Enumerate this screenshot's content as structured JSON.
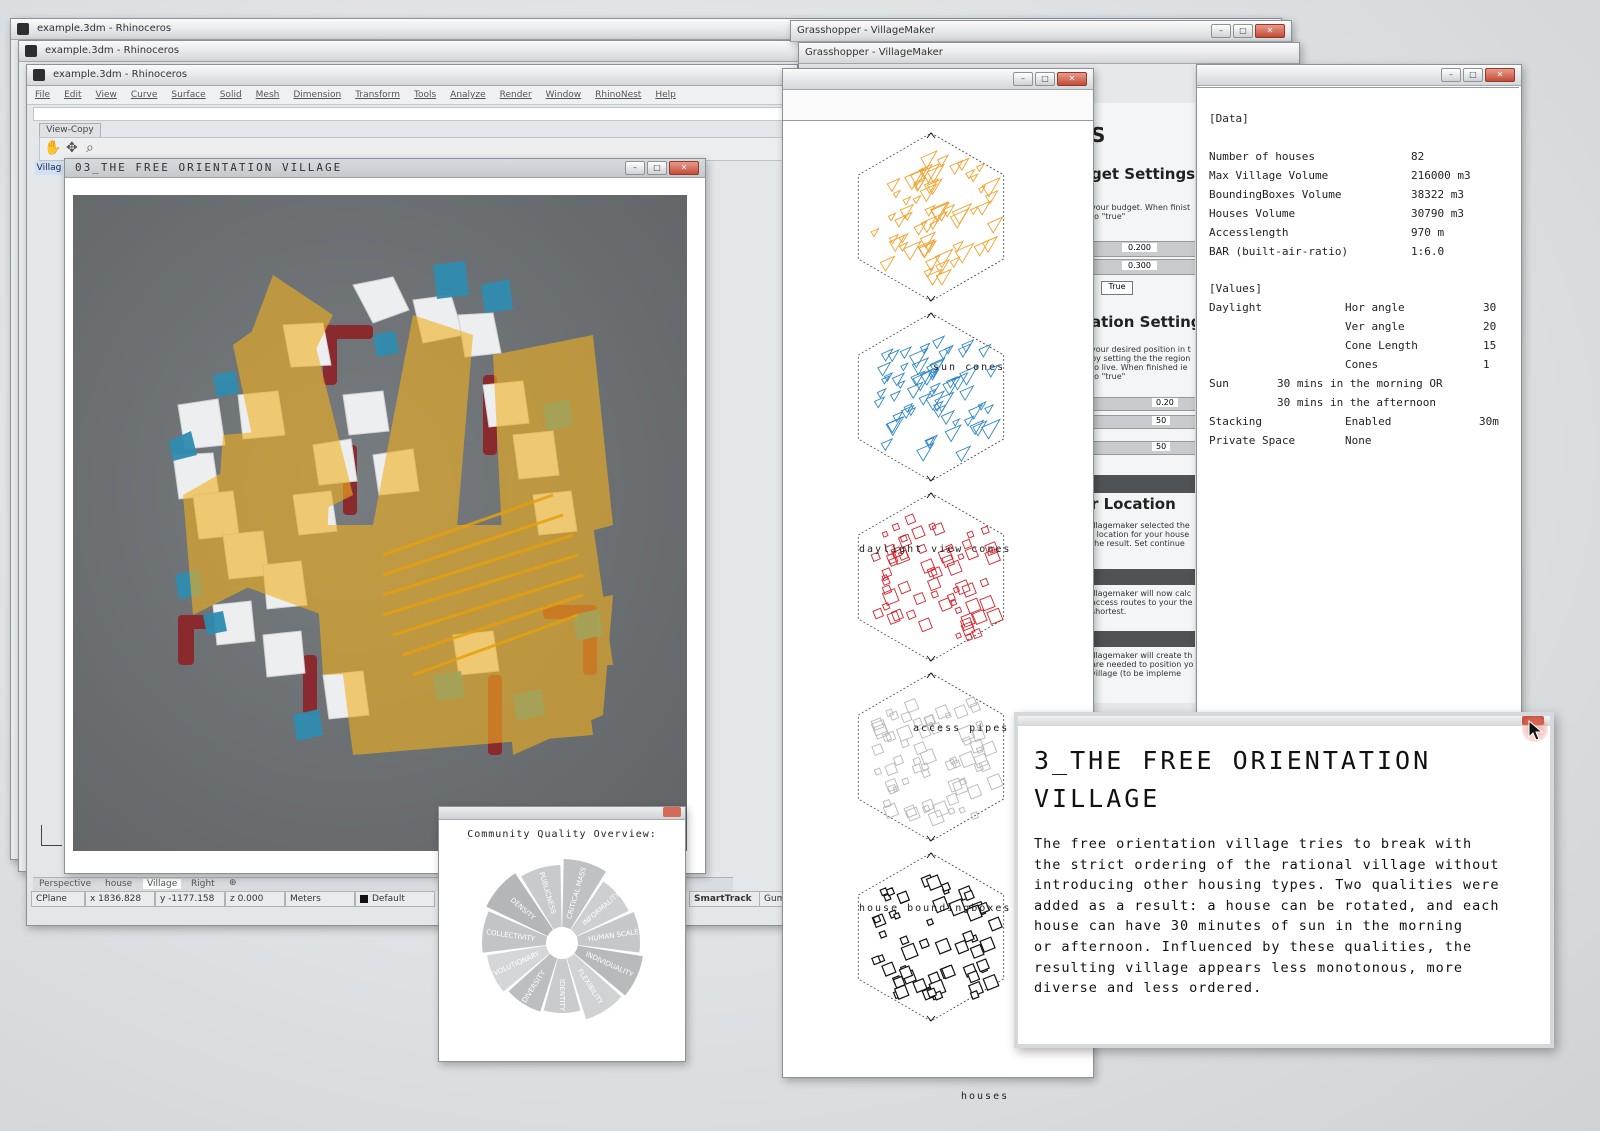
{
  "rhino_back1": {
    "title": "example.3dm - Rhinoceros"
  },
  "rhino_back2": {
    "title": "example.3dm - Rhinoceros"
  },
  "rhino_main": {
    "title": "example.3dm - Rhinoceros",
    "menu": [
      "File",
      "Edit",
      "View",
      "Curve",
      "Surface",
      "Solid",
      "Mesh",
      "Dimension",
      "Transform",
      "Tools",
      "Analyze",
      "Render",
      "Window",
      "RhinoNest",
      "Help"
    ],
    "toolbar_label": "View-Copy",
    "viewport_tabs": [
      "Perspective",
      "house",
      "Village",
      "Right"
    ],
    "left_tab": "Villag",
    "status": {
      "plane": "CPlane",
      "x": "x 1836.828",
      "y": "y -1177.158",
      "z": "z 0.000",
      "units": "Meters",
      "layer": "Default",
      "smarttrack": "SmartTrack",
      "extra": "Gum"
    }
  },
  "viewport_window": {
    "title": "03_THE FREE ORIENTATION VILLAGE"
  },
  "grasshopper_back": {
    "title": "Grasshopper - VillageMaker"
  },
  "grasshopper_front": {
    "title": "Grasshopper - VillageMaker"
  },
  "gh_panel": {
    "heading": "S",
    "section1": "get Settings",
    "text1": "your budget. When finist to \"true\"",
    "slider1": "0.200",
    "slider2": "0.300",
    "toggle": "True",
    "section2": "ation Settings",
    "text2": "your desired position in t by setting the the region to live. When finished ie to \"true\"",
    "slider3": "0.20",
    "slider4": "50",
    "slider5": "50",
    "section3": "r Location",
    "text3": "illagemaker selected the t location for your house the result. Set continue",
    "text4": "illagemaker will now calc access routes to your the shortest.",
    "text5": "illagemaker will create th are needed to position yo village (to be impleme"
  },
  "diagrams": {
    "labels": [
      "sun cones",
      "daylight view cones",
      "access pipes",
      "house boundingboxes",
      "houses"
    ],
    "colors": [
      "#f2a12a",
      "#2f86c8",
      "#d9202a",
      "#b8b8b8",
      "#111111"
    ]
  },
  "data_panel": {
    "data_header": "[Data]",
    "rows": [
      {
        "k": "Number of houses",
        "v": "82"
      },
      {
        "k": "Max Village Volume",
        "v": "216000 m3"
      },
      {
        "k": "BoundingBoxes Volume",
        "v": "38322 m3"
      },
      {
        "k": "Houses Volume",
        "v": "30790 m3"
      },
      {
        "k": "Accesslength",
        "v": "970 m"
      },
      {
        "k": "BAR (built-air-ratio)",
        "v": "1:6.0"
      }
    ],
    "values_header": "[Values]",
    "daylight_label": "Daylight",
    "daylight": [
      {
        "k": "Hor angle",
        "v": "30"
      },
      {
        "k": "Ver angle",
        "v": "20"
      },
      {
        "k": "Cone Length",
        "v": "15"
      },
      {
        "k": "Cones",
        "v": "1"
      }
    ],
    "sun_label": "Sun",
    "sun_line1": "30 mins in the morning OR",
    "sun_line2": "30 mins in the afternoon",
    "stacking_label": "Stacking",
    "stacking_value": "Enabled",
    "stacking_extra": "30m",
    "private_label": "Private Space",
    "private_value": "None"
  },
  "quality": {
    "title": "Community Quality Overview:",
    "segments": [
      "CRITICAL MASS",
      "INFORMALITY",
      "HUMAN SCALE",
      "INDIVIDUALITY",
      "FLEXIBILITY",
      "IDENTITY",
      "DIVERSITY",
      "EVOLUTIONARY",
      "COLLECTIVITY",
      "DENSITY",
      "PUBLICNESS"
    ]
  },
  "description": {
    "title_line1": "3_THE FREE ORIENTATION",
    "title_line2": "VILLAGE",
    "body": [
      "The free orientation village tries to break with",
      "the strict ordering of the rational village without",
      "introducing other housing types. Two qualities were",
      "added as a result: a house can be rotated, and each",
      "house can have 30 minutes of sun in the morning",
      "or afternoon. Influenced by these qualities, the",
      "resulting village appears less monotonous, more",
      "diverse and less ordered."
    ]
  }
}
